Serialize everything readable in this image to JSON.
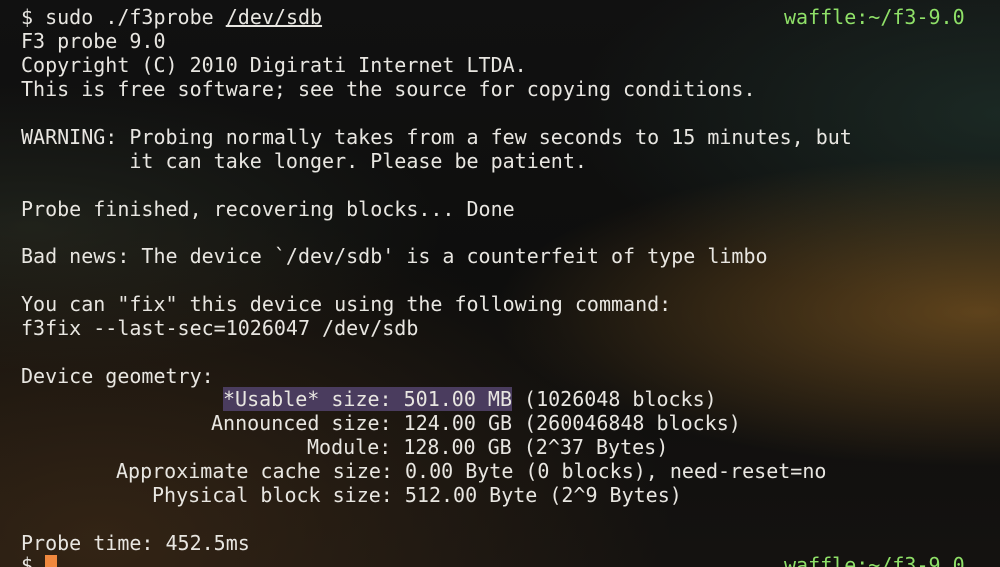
{
  "terminal": {
    "prompt_symbol": "$",
    "command": {
      "program": "sudo",
      "executable": "./f3probe",
      "argument": "/dev/sdb"
    },
    "hostname_path": "waffle:~/f3-9.0",
    "output": {
      "version": "F3 probe 9.0",
      "copyright": "Copyright (C) 2010 Digirati Internet LTDA.",
      "license": "This is free software; see the source for copying conditions.",
      "warning_1": "WARNING: Probing normally takes from a few seconds to 15 minutes, but",
      "warning_2": "         it can take longer. Please be patient.",
      "status": "Probe finished, recovering blocks... Done",
      "bad_news": "Bad news: The device `/dev/sdb' is a counterfeit of type limbo",
      "fix_hint": "You can \"fix\" this device using the following command:",
      "fix_command": "f3fix --last-sec=1026047 /dev/sdb",
      "geometry_header": "Device geometry:",
      "usable_label": "*Usable* size: 501.00 MB",
      "usable_rest": " (1026048 blocks)",
      "announced": "Announced size: 124.00 GB (260046848 blocks)",
      "module": "Module: 128.00 GB (2^37 Bytes)",
      "cache": "Approximate cache size: 0.00 Byte (0 blocks), need-reset=no",
      "physical": "Physical block size: 512.00 Byte (2^9 Bytes)",
      "probe_time": "Probe time: 452.5ms"
    },
    "next_prompt_symbol": "$"
  },
  "colors": {
    "text": "#e8e6e1",
    "hostname": "#8fe068",
    "highlight": "#4a3c5e",
    "cursor": "#f0883e"
  }
}
